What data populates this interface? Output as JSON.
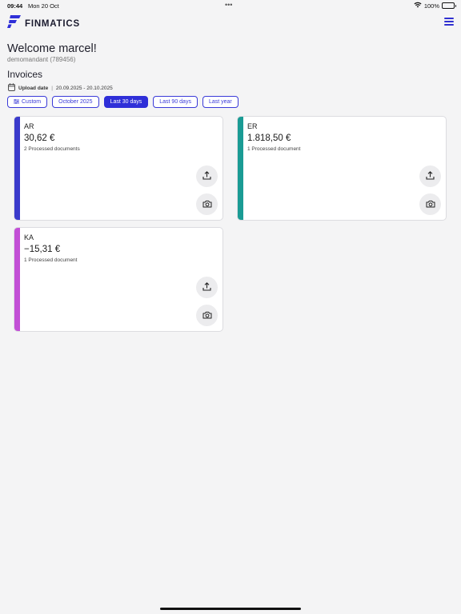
{
  "status": {
    "time": "09:44",
    "date": "Mon 20 Oct",
    "dots": "•••",
    "battery": "100%"
  },
  "app": {
    "name": "FINMATICS",
    "brand_color": "#2f2fd8"
  },
  "welcome": {
    "title": "Welcome marcel!",
    "account": "demomandant (789456)"
  },
  "invoices": {
    "section_title": "Invoices",
    "upload_label": "Upload date",
    "upload_range": "20.09.2025 - 20.10.2025"
  },
  "filters": [
    {
      "label": "Custom",
      "active": false
    },
    {
      "label": "October 2025",
      "active": false
    },
    {
      "label": "Last 30 days",
      "active": true
    },
    {
      "label": "Last 90 days",
      "active": false
    },
    {
      "label": "Last year",
      "active": false
    }
  ],
  "cards": [
    {
      "code": "AR",
      "amount": "30,62 €",
      "docs": "2 Processed documents",
      "color": "#3a3acb"
    },
    {
      "code": "ER",
      "amount": "1.818,50 €",
      "docs": "1 Processed document",
      "color": "#1a9b94"
    },
    {
      "code": "KA",
      "amount": "−15,31 €",
      "docs": "1 Processed document",
      "color": "#c24fd6"
    }
  ]
}
